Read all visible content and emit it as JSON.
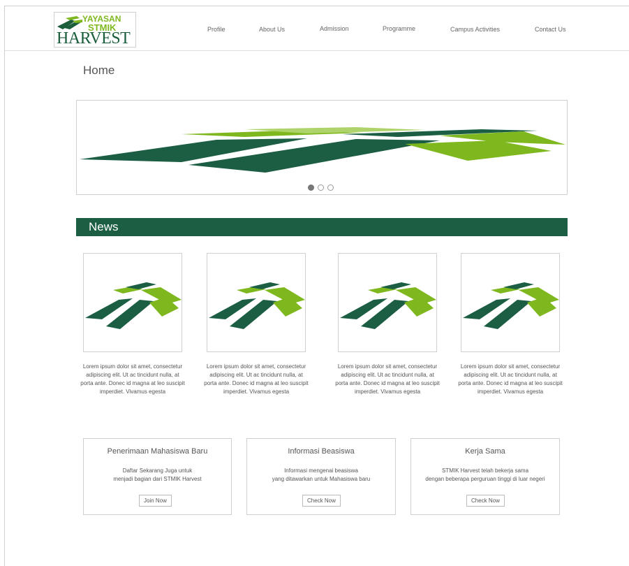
{
  "logo": {
    "line1": "YAYASAN",
    "line2": "STMIK",
    "line3": "HARVEST"
  },
  "nav": [
    {
      "label": "Profile"
    },
    {
      "label": "About Us"
    },
    {
      "label": "Admission"
    },
    {
      "label": "Programme"
    },
    {
      "label": "Campus Activities"
    },
    {
      "label": "Contact Us"
    }
  ],
  "page": {
    "title": "Home"
  },
  "slider": {
    "active_slide": 1,
    "slide_count": 3
  },
  "news": {
    "heading": "News",
    "items": [
      {
        "text": "Lorem ipsum dolor sit amet, consectetur adipiscing elit. Ut ac tincidunt nulla, at porta ante. Donec id magna at leo suscipit imperdiet. Vivamus egesta"
      },
      {
        "text": "Lorem ipsum dolor sit amet, consectetur adipiscing elit. Ut ac tincidunt nulla, at porta ante. Donec id magna at leo suscipit imperdiet. Vivamus egesta"
      },
      {
        "text": "Lorem ipsum dolor sit amet, consectetur adipiscing elit. Ut ac tincidunt nulla, at porta ante. Donec id magna at leo suscipit imperdiet. Vivamus egesta"
      },
      {
        "text": "Lorem ipsum dolor sit amet, consectetur adipiscing elit. Ut ac tincidunt nulla, at porta ante. Donec id magna at leo suscipit imperdiet. Vivamus egesta"
      }
    ]
  },
  "boxes": [
    {
      "title": "Penerimaan Mahasiswa Baru",
      "line1": "Daftar Sekarang Juga untuk",
      "line2": "menjadi bagian dari STMIK Harvest",
      "button": "Join Now"
    },
    {
      "title": "Informasi Beasiswa",
      "line1": "Informasi mengenai beasiswa",
      "line2": "yang ditawarkan untuk Mahasiswa baru",
      "button": "Check Now"
    },
    {
      "title": "Kerja Sama",
      "line1": "STMIK Harvest telah bekerja sama",
      "line2": "dengan beberapa perguruan tinggi di luar negeri",
      "button": "Check Now"
    }
  ],
  "colors": {
    "dark_green": "#1b5e43",
    "light_green": "#7fb81e"
  }
}
